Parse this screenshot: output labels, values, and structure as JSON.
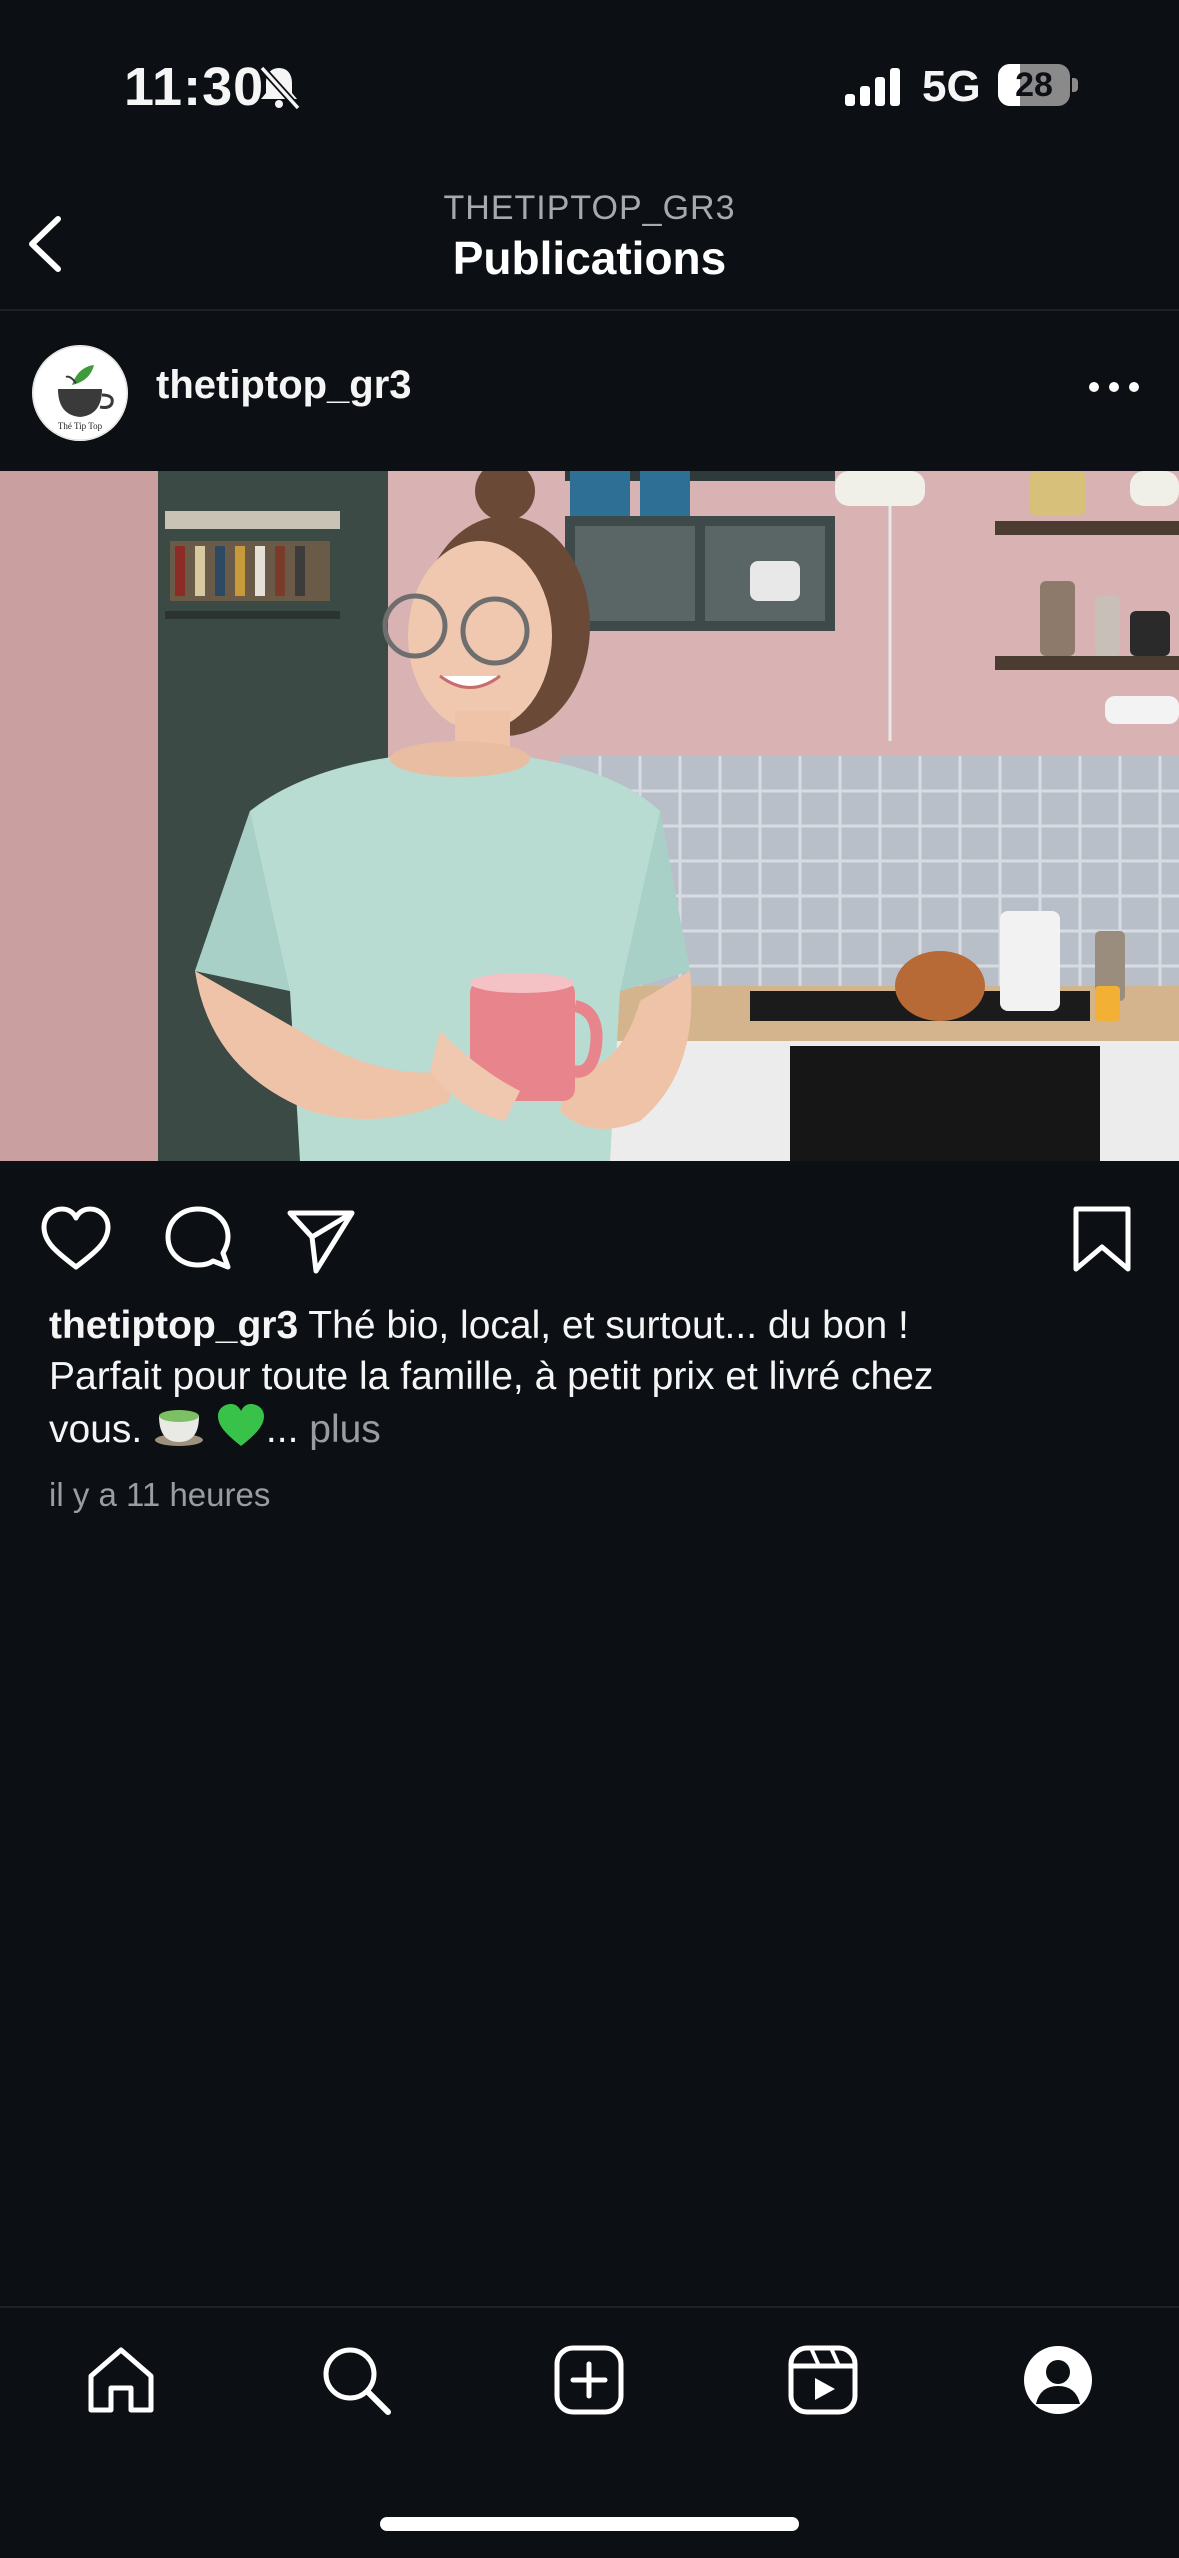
{
  "status_bar": {
    "time": "11:30",
    "network": "5G",
    "battery": "28"
  },
  "header": {
    "account": "THETIPTOP_GR3",
    "title": "Publications"
  },
  "post": {
    "username": "thetiptop_gr3",
    "avatar_text": "Thé Tip Top",
    "caption_user": "thetiptop_gr3",
    "caption_line1": " Thé bio, local, et surtout... du bon !",
    "caption_line2": "Parfait pour toute la famille, à petit prix et livré chez",
    "caption_line3": "vous. ",
    "caption_emoji_tea": "🍵",
    "caption_emoji_heart": "💚",
    "caption_ellipsis": "... ",
    "more_label": "plus",
    "timestamp": "il y a 11 heures"
  },
  "icons": {
    "header": [
      "back-icon"
    ],
    "post": [
      "more-icon",
      "like-icon",
      "comment-icon",
      "share-icon",
      "save-icon"
    ],
    "tabbar": [
      "home-icon",
      "search-icon",
      "create-icon",
      "reels-icon",
      "profile-icon"
    ]
  },
  "colors": {
    "background": "#0c0f14",
    "text": "#f5f5f5",
    "muted": "#9a9ca1",
    "heart_emoji": "#39c24a"
  }
}
